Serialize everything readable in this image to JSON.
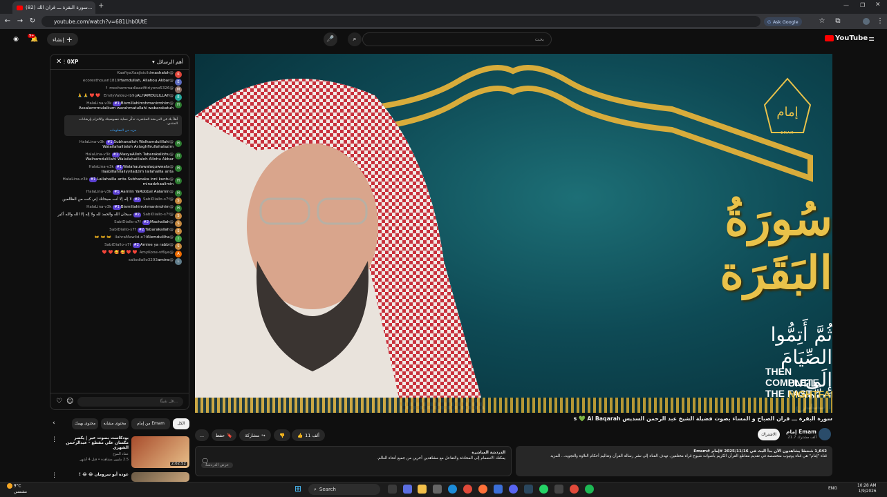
{
  "browser": {
    "tab_title": "(82) سورة البقرة ـــ قران الك...",
    "url": "youtube.com/watch?v=681Lhb0UtE",
    "ask_google": "Ask Google"
  },
  "youtube": {
    "logo": "YouTube",
    "search_placeholder": "بحث",
    "create_label": "إنشاء",
    "notif_count": "9+"
  },
  "chat": {
    "header": "أهم الرسائل",
    "points": "0XP",
    "messages": [
      {
        "author": "@KaafiyaXaajisicild",
        "text": "mashaloh",
        "avatar": "K",
        "color": "#e0463b"
      },
      {
        "author": "@ecoresthouari1819",
        "text": "Hamdullah, Allahou Akbar",
        "avatar": "E",
        "color": "#5c6bc0"
      },
      {
        "author": "@mochammadlaazifitriyono5326",
        "text": "!",
        "avatar": "M",
        "color": "#8d6e63"
      },
      {
        "author": "@EmilyValdez-Ib9g",
        "text": "ALHAMDULILLAH ❤️ ❤️ 🙏 🙏",
        "avatar": "E",
        "color": "#26a69a"
      },
      {
        "author": "@HalaLina-v3k",
        "badge": "#1",
        "text": "Bismillahirrohmanirrohim Assalamrmulaikum warahmatullahi wabarakatuh",
        "avatar": "H",
        "color": "#2e7d32"
      },
      {
        "author": "@HalaLina-v3k",
        "badge": "#1",
        "text": "Subhanalloh Walhamdulillahi Walailahaillaloh Astaghfirullahalazim",
        "avatar": "H",
        "color": "#2e7d32"
      },
      {
        "author": "@HalaLina-v3k",
        "badge": "#1",
        "text": "MasyaAlloh Tabarakallohu Walhamdulillahi Walailahaillaloh Allohu Akbar",
        "avatar": "H",
        "color": "#2e7d32"
      },
      {
        "author": "@HalaLina-v3k",
        "badge": "#1",
        "text": "Walahaulawalaquwwata Ilaabillahilaliyyiladzim lailahailla anta",
        "avatar": "H",
        "color": "#2e7d32"
      },
      {
        "author": "@HalaLina-v3k",
        "badge": "#1",
        "text": "Lailahailla anta Subhanaka inni kuntu minadzhaalimin",
        "avatar": "H",
        "color": "#2e7d32"
      },
      {
        "author": "@HalaLina-v3k",
        "badge": "#1",
        "text": "Aamiin YaRobbal Aalamin",
        "avatar": "H",
        "color": "#2e7d32"
      },
      {
        "author": "@SabiDiallo-s7f",
        "badge": "#2",
        "text": "لا إله إلا أنت سبحانك إني كنت من الظالمين",
        "avatar": "S",
        "color": "#c6893f"
      },
      {
        "author": "@HalaLina-v3k",
        "badge": "#1",
        "text": "Bismillahirrohmanirrohim",
        "avatar": "H",
        "color": "#2e7d32"
      },
      {
        "author": "@SabiDiallo-s7f",
        "badge": "#2",
        "text": "سبحان الله والحمد لله ولا إله إلا الله والله أكبر",
        "avatar": "S",
        "color": "#c6893f"
      },
      {
        "author": "@SabiDiallo-s7f",
        "badge": "#2",
        "text": "Machallah",
        "avatar": "S",
        "color": "#c6893f"
      },
      {
        "author": "@SabiDiallo-s7f",
        "badge": "#2",
        "text": "Tabarakallah",
        "avatar": "S",
        "color": "#c6893f"
      },
      {
        "author": "@llahraMawlid-e7f",
        "text": "Alemdulilha 👐 👐 👐",
        "avatar": "I",
        "color": "#43a047"
      },
      {
        "author": "@SabiDiallo-s7f",
        "badge": "#2",
        "text": "Amine ya rabbi",
        "avatar": "S",
        "color": "#c6893f"
      },
      {
        "author": "@AmyKone-vf6ye",
        "text": "❤️ ❤️ 🥰 🥰 ❤️ ❤️",
        "avatar": "A",
        "color": "#ef6c00"
      },
      {
        "author": "@saliodiallo3293",
        "text": "amine",
        "avatar": "L",
        "color": "#607d8b"
      }
    ],
    "notice_text": "أهلاً بك في الدردشة المباشرة. تذكّر حماية خصوصيتك والالتزام بإرشادات المنتدى.",
    "notice_link": "مزيد من المعلومات",
    "input_placeholder": "قل شيئًا..."
  },
  "video": {
    "surah_title": "سُورَةُ البَقَرَة",
    "verse_ar": "ثُمَّ أَتِمُّوا الصِّيَامَ إِلَى اللَّيْلِ",
    "caption_line1": "THEN COMPLETE THE FAST",
    "caption_line2a": "UNTIL ",
    "caption_line2b": "NIGHTFALL",
    "brand_name": "إمام",
    "brand_small": "EMAM",
    "title": "سورة البقرة ـــ قران الصباح و المساء بصوت فضيلة الشيخ عبد الرحمن السديس AlSudais 💚 Al Baqarah"
  },
  "channel": {
    "name": "إمام Emam",
    "subs": "21.7 ألف مشترك",
    "subscribe": "الاشتراك"
  },
  "actions": {
    "likes": "11 ألف",
    "share": "مشاركة",
    "save": "حفظ",
    "more": "..."
  },
  "description": {
    "meta": "1,642 شخصًا يشاهدون الآن  بدأ البث في 2025/11/16  #إمام #Emam",
    "body": "قناة \"إمام\" هي قناة يوتيوب متخصصة في تقديم مقاطع القرآن الكريم بأصوات شيوخ قراء مختلفين. تهدف القناة إلى نشر رسالة القرآن وتعاليم أحكام التلاوة والتجويد... المزيد"
  },
  "live_chat_box": {
    "header": "الدردشة المباشرة",
    "text": "يمكنك الانضمام إلى المحادثة والتفاعل مع مشاهدين آخرين من جميع أنحاء العالم.",
    "button": "عرض الدردشة"
  },
  "related": {
    "chips": [
      "الكل",
      "من إمام Emam",
      "محتوى مشابه",
      "محتوى يهمك"
    ],
    "items": [
      {
        "title": "بودكاست بصوت خبر | يكسر مكسان علي مقطع - عبدالرحمن الشهري",
        "channel": "عماد الموح",
        "meta": "2.5 مليون مشاهدة • قبل 4 أشهر",
        "duration": "2:02:52"
      },
      {
        "title": "عودة أبو سرومان 😂 😂 !",
        "channel": "",
        "meta": "",
        "duration": ""
      }
    ]
  },
  "taskbar": {
    "search": "Search",
    "weather_temp": "9°C",
    "weather_desc": "مشمس",
    "lang": "ENG",
    "time": "10:28 AM",
    "date": "1/9/2026"
  }
}
